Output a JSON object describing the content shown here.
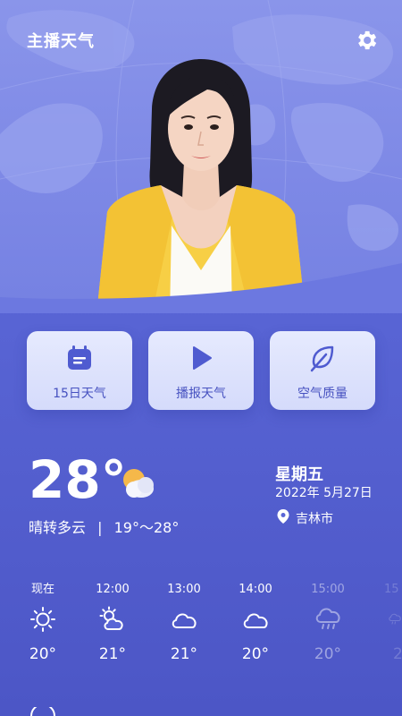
{
  "header": {
    "title": "主播天气",
    "settings_icon": "gear-icon"
  },
  "hero": {
    "image": "news-anchor-woman-yellow-jacket",
    "background": "world-map"
  },
  "actions": [
    {
      "label": "15日天气",
      "icon": "calendar-icon"
    },
    {
      "label": "播报天气",
      "icon": "play-icon"
    },
    {
      "label": "空气质量",
      "icon": "leaf-icon"
    }
  ],
  "current": {
    "temperature": "28°",
    "condition": "晴转多云",
    "separator": "|",
    "range": "19°～28°",
    "condition_icon": "partly-cloudy-icon",
    "weekday": "星期五",
    "date": "2022年 5月27日",
    "location_icon": "location-pin-icon",
    "city": "吉林市"
  },
  "hourly": [
    {
      "time": "现在",
      "icon": "sun-icon",
      "temp": "20°"
    },
    {
      "time": "12:00",
      "icon": "partly-cloudy-icon",
      "temp": "21°"
    },
    {
      "time": "13:00",
      "icon": "cloud-icon",
      "temp": "21°"
    },
    {
      "time": "14:00",
      "icon": "cloud-icon",
      "temp": "20°"
    },
    {
      "time": "15:00",
      "icon": "rain-icon",
      "temp": "20°"
    },
    {
      "time": "15",
      "icon": "rain-icon",
      "temp": "2"
    }
  ],
  "colors": {
    "accent": "#4651c0",
    "card_bg": "#e2e6fd",
    "jacket": "#f7cf45",
    "sun": "#f5b84a"
  }
}
